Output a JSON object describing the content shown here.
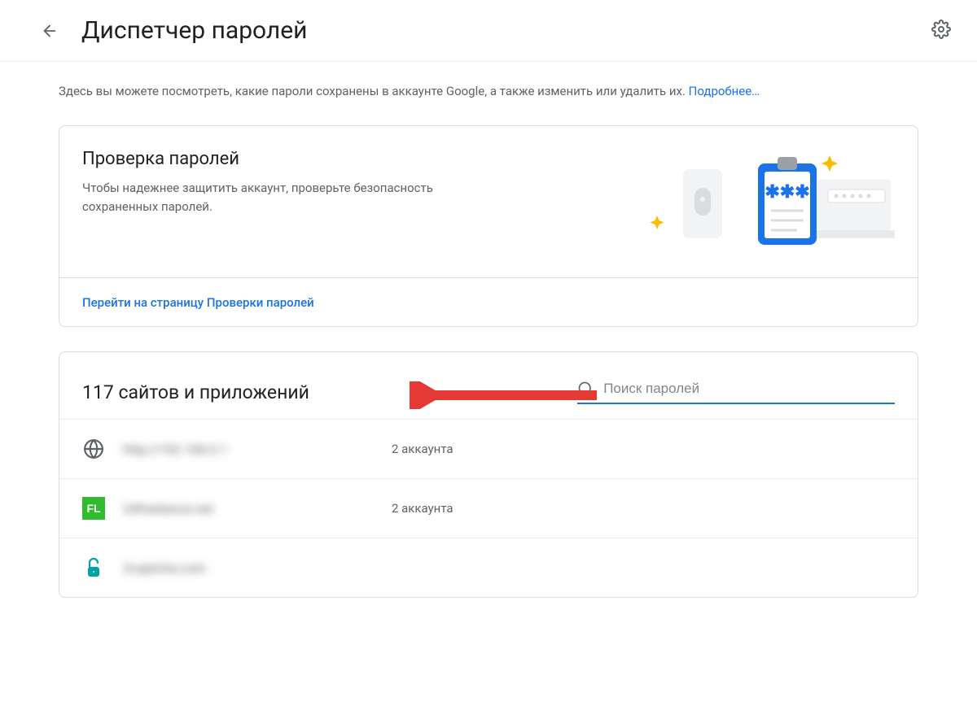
{
  "header": {
    "title": "Диспетчер паролей"
  },
  "intro": {
    "text": "Здесь вы можете посмотреть, какие пароли сохранены в аккаунте Google, а также изменить или удалить их. ",
    "link": "Подробнее…"
  },
  "checkup": {
    "title": "Проверка паролей",
    "desc": "Чтобы надежнее защитить аккаунт, проверьте безопасность сохраненных паролей.",
    "cta": "Перейти на страницу Проверки паролей"
  },
  "list": {
    "title": "117 сайтов и приложений",
    "search_placeholder": "Поиск паролей",
    "rows": [
      {
        "icon": "globe",
        "site": "http://192.168.0.1",
        "count": "2 аккаунта"
      },
      {
        "icon": "fl",
        "site": "24freelance.net",
        "count": "2 аккаунта"
      },
      {
        "icon": "lock",
        "site": "2captcha.com",
        "count": ""
      }
    ]
  }
}
